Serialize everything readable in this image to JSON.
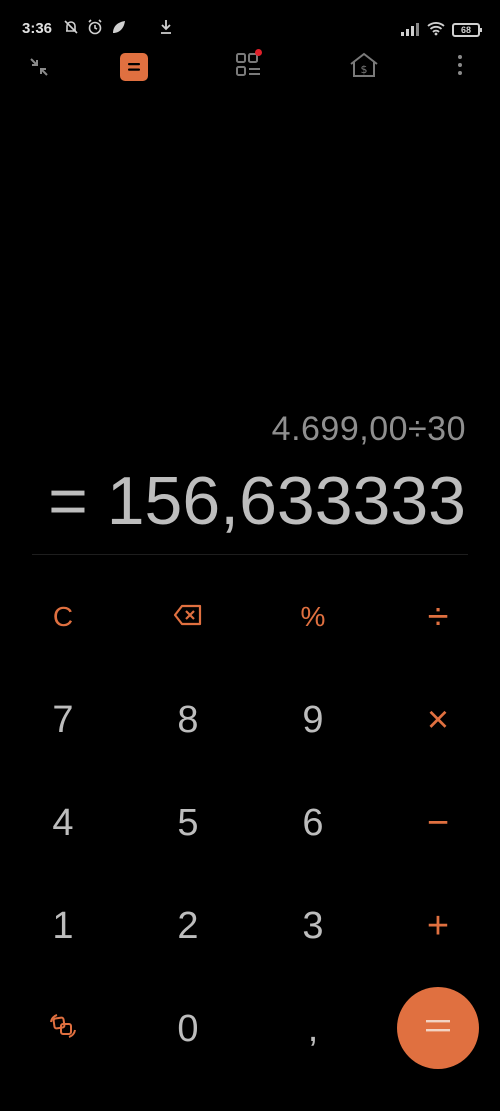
{
  "status_bar": {
    "time": "3:36",
    "battery_level": "68"
  },
  "toolbar": {
    "icons": [
      "collapse-icon",
      "calculator-mode-icon",
      "apps-grid-icon",
      "currency-icon",
      "more-icon"
    ],
    "accent": "#e07040",
    "notification_dot_color": "#e0202a"
  },
  "display": {
    "expression": "4.699,00÷30",
    "result": "= 156,633333"
  },
  "keypad": {
    "row1": [
      "C",
      "⌫",
      "%",
      "÷"
    ],
    "row2": [
      "7",
      "8",
      "9",
      "×"
    ],
    "row3": [
      "4",
      "5",
      "6",
      "−"
    ],
    "row4": [
      "1",
      "2",
      "3",
      "+"
    ],
    "row5": [
      "swap",
      "0",
      ",",
      "="
    ]
  },
  "colors": {
    "background": "#000000",
    "digits": "#bdbdbd",
    "operators": "#e07040"
  }
}
